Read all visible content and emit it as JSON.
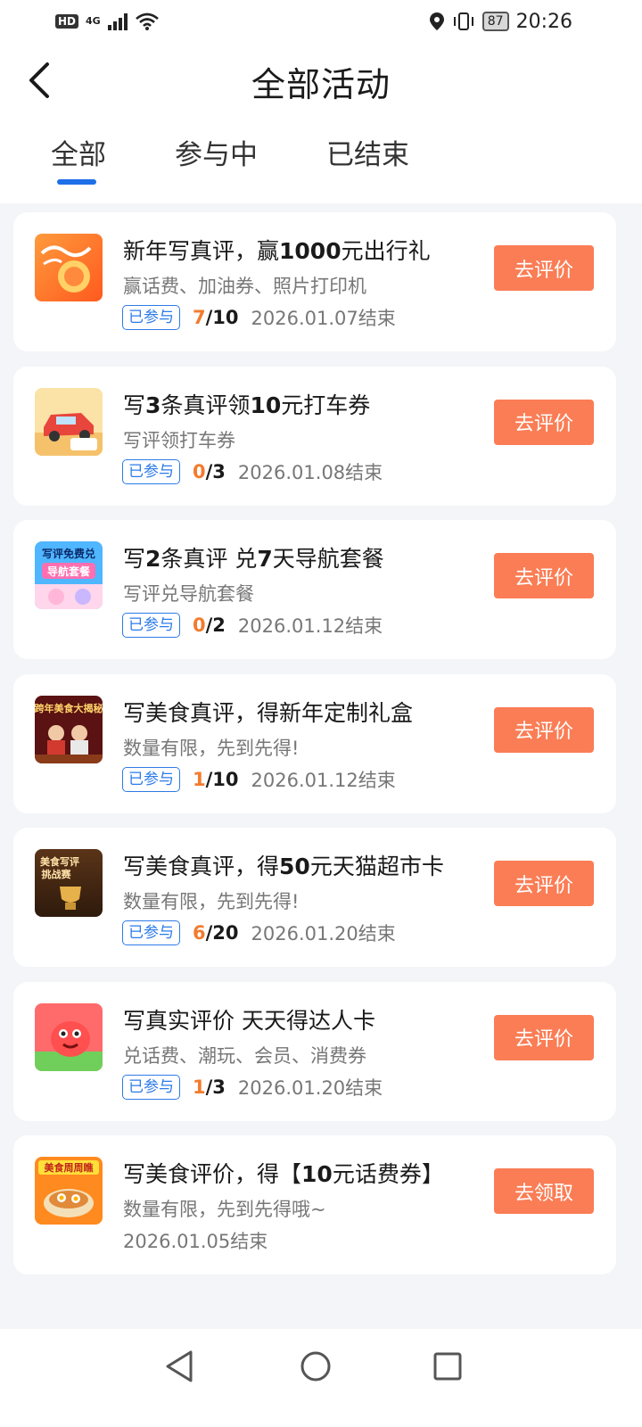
{
  "status_bar": {
    "hd": "HD",
    "network": "4G",
    "battery": "87",
    "time": "20:26",
    "icons": [
      "hd-icon",
      "signal-icon",
      "wifi-icon",
      "location-icon",
      "vibrate-icon",
      "battery-icon"
    ]
  },
  "header": {
    "title": "全部活动",
    "back_icon": "back-chevron-icon"
  },
  "tabs": [
    {
      "label": "全部",
      "active": true
    },
    {
      "label": "参与中",
      "active": false
    },
    {
      "label": "已结束",
      "active": false
    }
  ],
  "colors": {
    "accent_blue": "#1e6fe8",
    "button_orange": "#fa7d55",
    "progress_orange": "#f37b2e",
    "page_bg": "#f3f5f8"
  },
  "activities": [
    {
      "title_parts": [
        "新年写真评，赢",
        "1000",
        "元出行礼"
      ],
      "subtitle": "赢话费、加油券、照片打印机",
      "badge": "已参与",
      "progress_done": "7",
      "progress_total": "/10",
      "end_date": "2026.01.07结束",
      "button": "去评价",
      "thumb": "new-year-travel-thumbnail"
    },
    {
      "title_parts": [
        "写",
        "3",
        "条真评领",
        "10",
        "元打车券"
      ],
      "subtitle": "写评领打车券",
      "badge": "已参与",
      "progress_done": "0",
      "progress_total": "/3",
      "end_date": "2026.01.08结束",
      "button": "去评价",
      "thumb": "car-coupon-thumbnail"
    },
    {
      "title_parts": [
        "写",
        "2",
        "条真评 兑",
        "7",
        "天导航套餐"
      ],
      "subtitle": "写评兑导航套餐",
      "badge": "已参与",
      "progress_done": "0",
      "progress_total": "/2",
      "end_date": "2026.01.12结束",
      "button": "去评价",
      "thumb": "navigation-package-thumbnail",
      "thumb_text": [
        "写评免费兑",
        "导航套餐"
      ]
    },
    {
      "title_parts": [
        "写美食真评，得新年定制礼盒"
      ],
      "subtitle": "数量有限，先到先得!",
      "badge": "已参与",
      "progress_done": "1",
      "progress_total": "/10",
      "end_date": "2026.01.12结束",
      "button": "去评价",
      "thumb": "food-gift-box-thumbnail",
      "thumb_text": [
        "跨年美食大揭秘"
      ]
    },
    {
      "title_parts": [
        "写美食真评，得",
        "50",
        "元天猫超市卡"
      ],
      "subtitle": "数量有限，先到先得!",
      "badge": "已参与",
      "progress_done": "6",
      "progress_total": "/20",
      "end_date": "2026.01.20结束",
      "button": "去评价",
      "thumb": "food-review-challenge-thumbnail",
      "thumb_text": [
        "美食写评",
        "挑战赛"
      ]
    },
    {
      "title_parts": [
        "写真实评价 天天得达人卡"
      ],
      "subtitle": "兑话费、潮玩、会员、消费券",
      "badge": "已参与",
      "progress_done": "1",
      "progress_total": "/3",
      "end_date": "2026.01.20结束",
      "button": "去评价",
      "thumb": "mascot-thumbnail"
    },
    {
      "title_parts": [
        "写美食评价，得【",
        "10",
        "元话费券】"
      ],
      "subtitle": "数量有限，先到先得哦~",
      "end_date": "2026.01.05结束",
      "button": "去领取",
      "thumb": "food-week-thumbnail",
      "thumb_text": [
        "美食周周瞧"
      ]
    }
  ],
  "system_nav": {
    "icons": [
      "nav-back-triangle-icon",
      "nav-home-circle-icon",
      "nav-recents-square-icon"
    ]
  }
}
